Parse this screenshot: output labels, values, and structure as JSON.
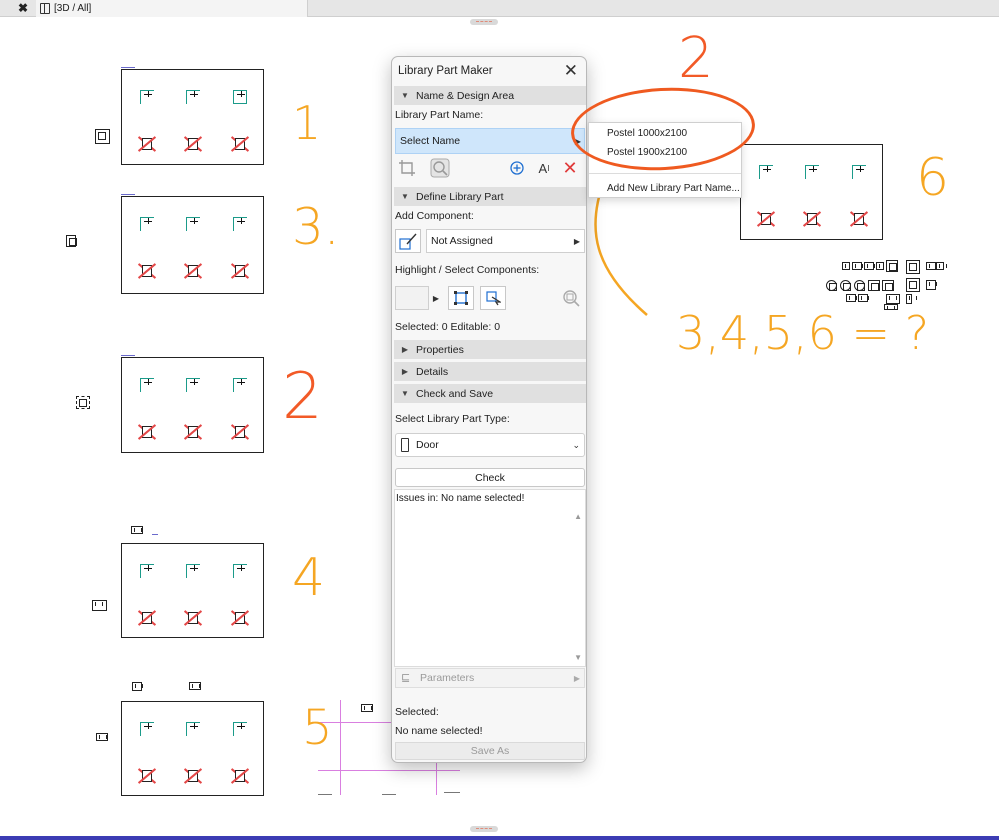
{
  "tabbar": {
    "tab_label": "[3D / All]",
    "close_glyph": "✖",
    "view_icon": "3d-view-icon"
  },
  "annotations": {
    "n1": "1",
    "n2_top": "2",
    "n3": "3.",
    "n2_mid": "2",
    "n4": "4",
    "n5": "5",
    "n6": "6",
    "question": "3,4,5,6 = ?",
    "color_orange": "#f5a623",
    "color_red": "#f25a27"
  },
  "dialog": {
    "title": "Library Part Maker",
    "close_glyph": "✕",
    "sections": {
      "name_design": "Name & Design Area",
      "define": "Define Library Part",
      "properties": "Properties",
      "details": "Details",
      "check_save": "Check and Save"
    },
    "library_part_name_label": "Library Part Name:",
    "select_name": "Select Name",
    "add_component_label": "Add Component:",
    "component_value": "Not Assigned",
    "highlight_label": "Highlight / Select Components:",
    "selected_editable": "Selected: 0 Editable: 0",
    "part_type_label": "Select Library Part Type:",
    "part_type_value": "Door",
    "check_button": "Check",
    "issues_text": "Issues in: No name selected!",
    "parameters": "Parameters",
    "selected_label": "Selected:",
    "no_name_selected": "No name selected!",
    "save_as": "Save As",
    "accent_red": "#e03a3a",
    "accent_blue": "#1f6fd1"
  },
  "popup": {
    "items": [
      "Postel 1000x2100",
      "Postel 1900x2100"
    ],
    "add_new": "Add New Library Part Name..."
  }
}
